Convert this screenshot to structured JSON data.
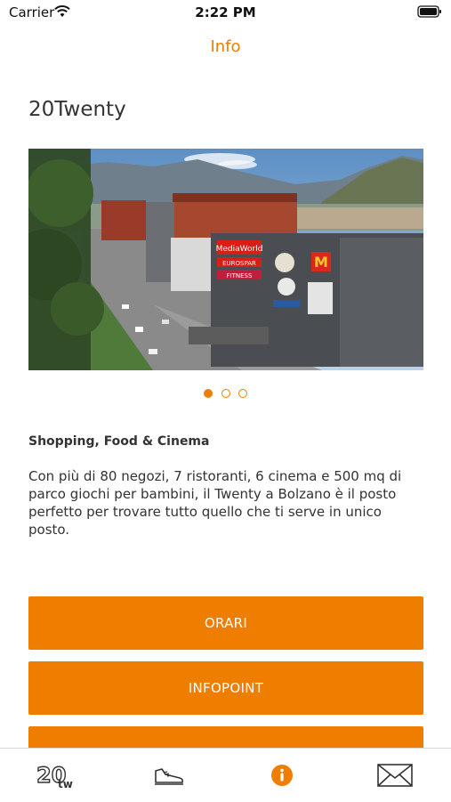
{
  "status_bar": {
    "carrier": "Carrier",
    "time": "2:22 PM"
  },
  "nav": {
    "title": "Info"
  },
  "page": {
    "title": "20Twenty"
  },
  "gallery": {
    "dots": [
      {
        "active": true
      },
      {
        "active": false
      },
      {
        "active": false
      }
    ],
    "signage": [
      "MediaWorld",
      "EUROSPAR",
      "FITNESS",
      "M"
    ]
  },
  "content": {
    "heading": "Shopping, Food & Cinema",
    "body": "Con più di 80 negozi, 7 ristoranti, 6 cinema e 500 mq di parco giochi per bambini, il Twenty a Bolzano è il posto perfetto per trovare tutto quello che ti serve in unico posto."
  },
  "buttons": {
    "hours": "ORARI",
    "infopoint": "INFOPOINT"
  },
  "tab_bar": {
    "logo_text": "20",
    "logo_sub": "tw",
    "active_color": "#ef7d00",
    "inactive_color": "#333333",
    "tabs": [
      {
        "icon": "twenty-logo-icon"
      },
      {
        "icon": "sneaker-icon"
      },
      {
        "icon": "info-icon"
      },
      {
        "icon": "envelope-icon"
      }
    ]
  },
  "colors": {
    "accent": "#ef7d00"
  }
}
